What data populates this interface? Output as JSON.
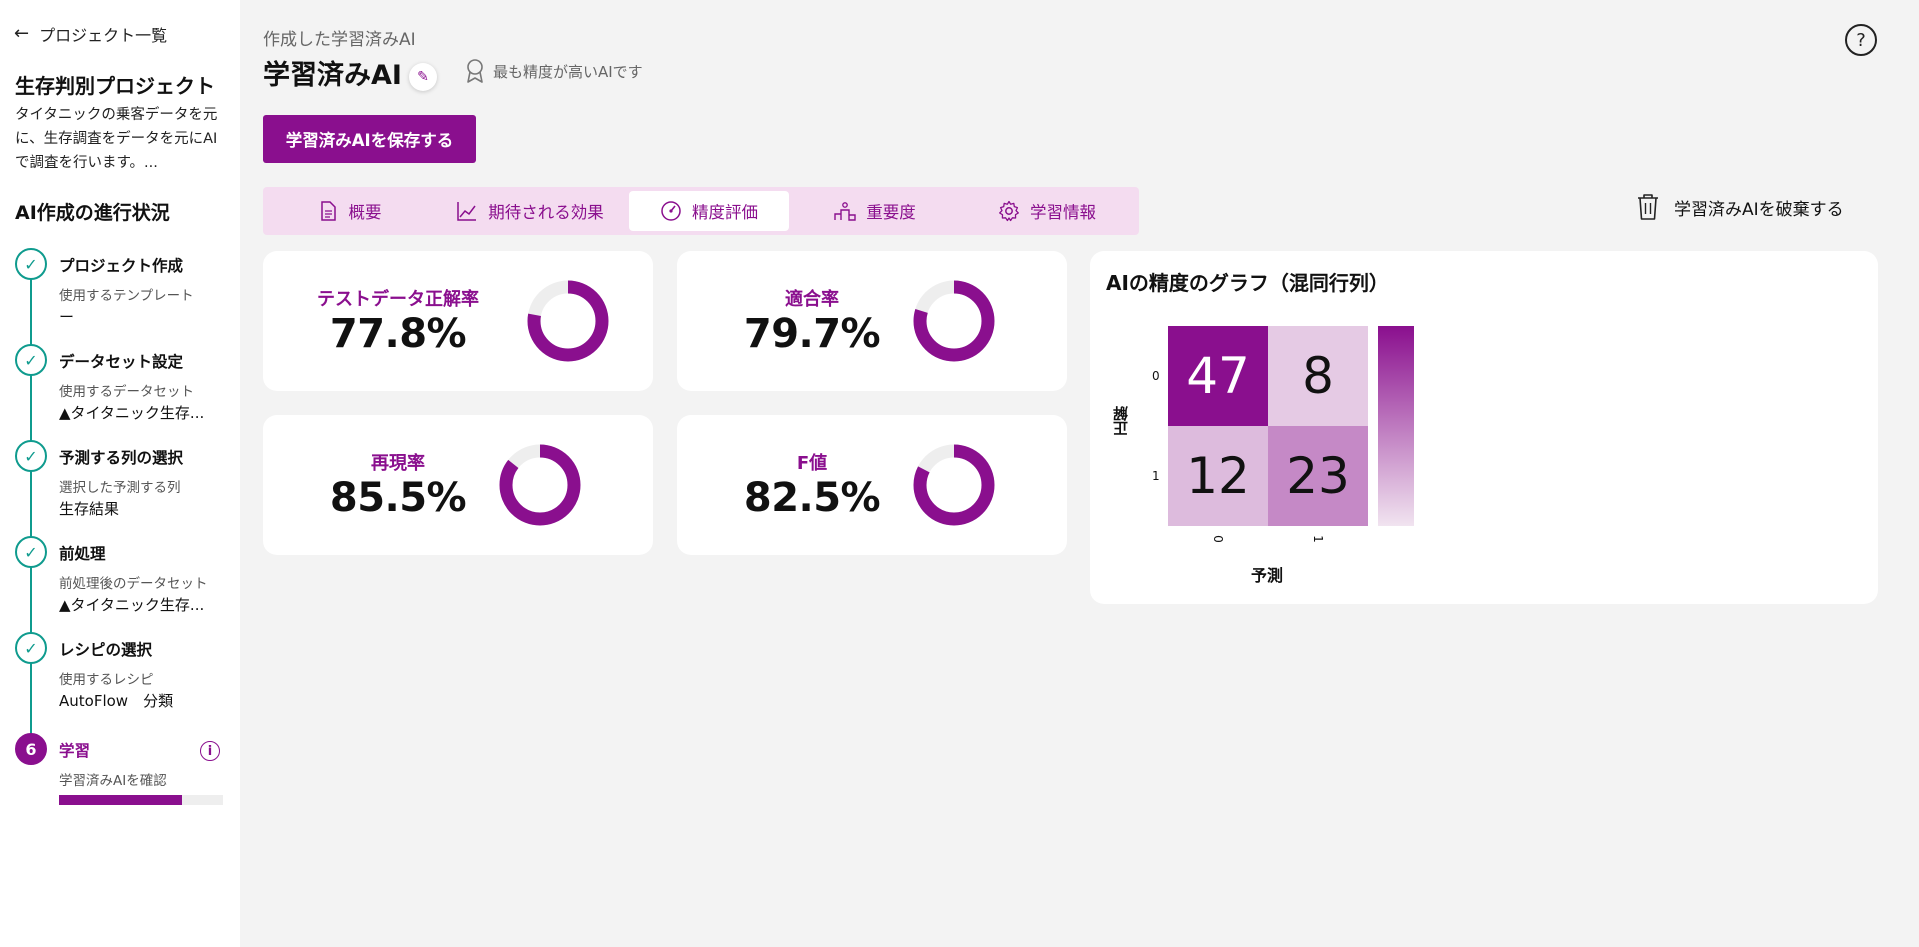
{
  "sidebar": {
    "back_label": "プロジェクト一覧",
    "project_title": "生存判別プロジェクト",
    "project_desc": "タイタニックの乗客データを元に、生存調査をデータを元にAIで調査を行います。...",
    "progress_title": "AI作成の進行状況",
    "steps": [
      {
        "title": "プロジェクト作成",
        "sub": "使用するテンプレート",
        "value": "ー"
      },
      {
        "title": "データセット設定",
        "sub": "使用するデータセット",
        "value": "▲タイタニック生存..."
      },
      {
        "title": "予測する列の選択",
        "sub": "選択した予測する列",
        "value": "生存結果"
      },
      {
        "title": "前処理",
        "sub": "前処理後のデータセット",
        "value": "▲タイタニック生存..."
      },
      {
        "title": "レシピの選択",
        "sub": "使用するレシピ",
        "value": "AutoFlow　分類"
      },
      {
        "number": "6",
        "title": "学習",
        "sub": "学習済みAIを確認",
        "progress": 0.75
      }
    ]
  },
  "header": {
    "crumb": "作成した学習済みAI",
    "title": "学習済みAI",
    "best_badge": "最も精度が高いAIです",
    "help": "?",
    "save_button": "学習済みAIを保存する",
    "discard_button": "学習済みAIを破棄する"
  },
  "tabs": [
    {
      "label": "概要",
      "icon": "document-icon"
    },
    {
      "label": "期待される効果",
      "icon": "line-chart-icon"
    },
    {
      "label": "精度評価",
      "icon": "gauge-icon",
      "active": true
    },
    {
      "label": "重要度",
      "icon": "podium-icon"
    },
    {
      "label": "学習情報",
      "icon": "gear-icon"
    }
  ],
  "metrics": [
    {
      "label": "テストデータ正解率",
      "value": "77.8%",
      "fraction": 0.778
    },
    {
      "label": "適合率",
      "value": "79.7%",
      "fraction": 0.797
    },
    {
      "label": "再現率",
      "value": "85.5%",
      "fraction": 0.855
    },
    {
      "label": "F値",
      "value": "82.5%",
      "fraction": 0.825
    }
  ],
  "chart_data": {
    "type": "heatmap",
    "title": "AIの精度のグラフ（混同行列）",
    "xlabel": "予測",
    "ylabel": "正解",
    "x_ticks": [
      "0",
      "1"
    ],
    "y_ticks": [
      "0",
      "1"
    ],
    "values": [
      [
        47,
        8
      ],
      [
        12,
        23
      ]
    ],
    "colorbar": true
  },
  "colors": {
    "accent": "#8a0f8e",
    "step": "#0f9b8e",
    "tab_bg": "#f4dcf0"
  }
}
